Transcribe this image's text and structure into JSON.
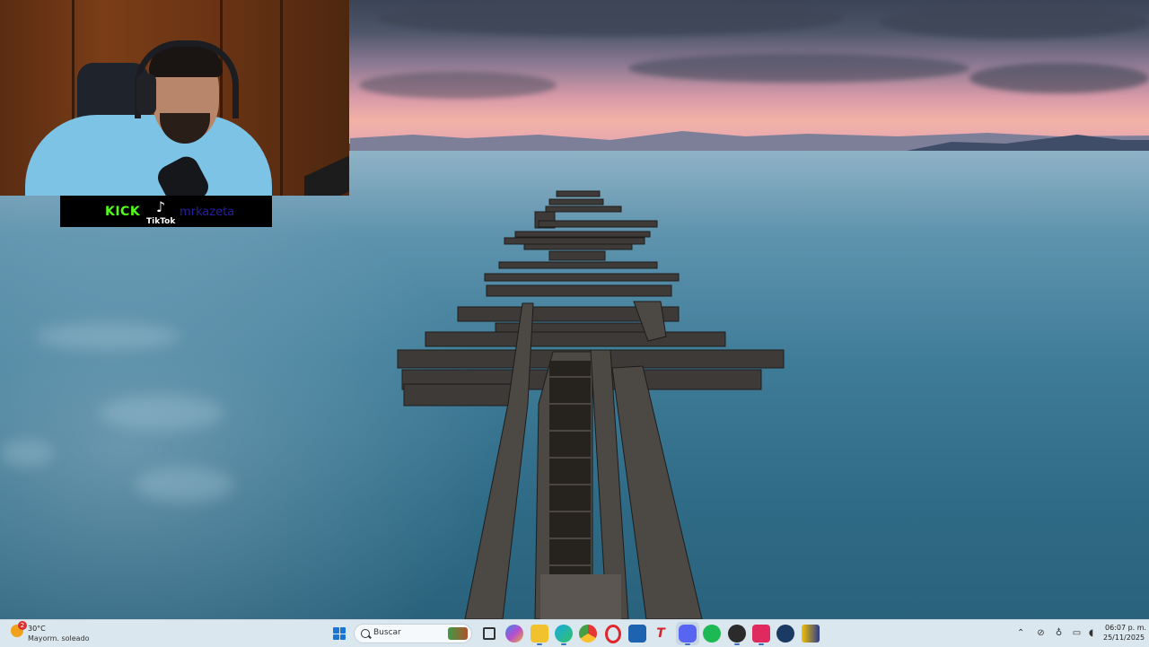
{
  "overlay": {
    "kick_label": "KICK",
    "tiktok_label": "TikTok",
    "channel_name": "mrkazeta"
  },
  "taskbar": {
    "weather": {
      "temperature": "30°C",
      "condition": "Mayorm. soleado",
      "badge": "2"
    },
    "search_placeholder": "Buscar",
    "pinned_apps": [
      "file-manager",
      "copilot",
      "folder",
      "edge",
      "chrome",
      "opera",
      "store",
      "typora",
      "discord",
      "spotify",
      "obs",
      "tiktok-live",
      "steam",
      "klite"
    ],
    "clock": {
      "time": "06:07 p. m.",
      "date": "25/11/2025"
    }
  },
  "colors": {
    "kick": "#53fc18",
    "channel": "#2a1d9e",
    "taskbar_bg": "#dbe7ef",
    "accent": "#1976d2"
  }
}
